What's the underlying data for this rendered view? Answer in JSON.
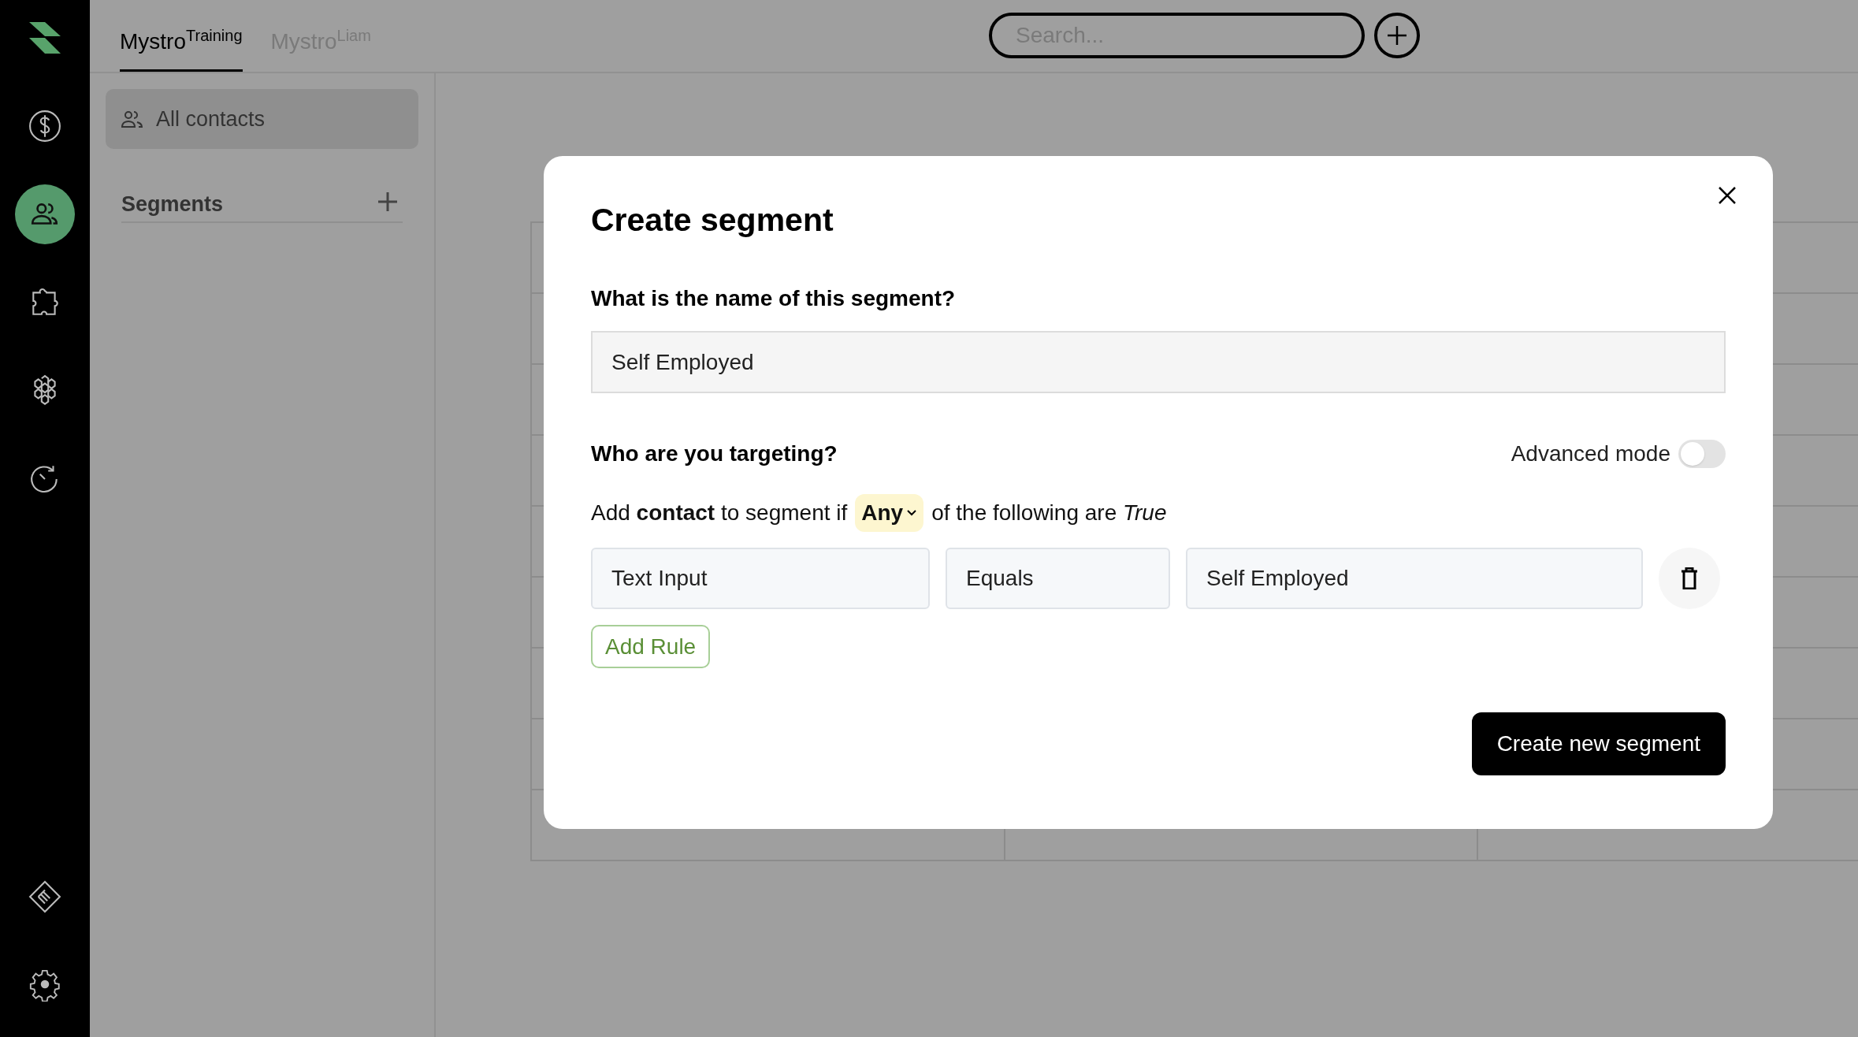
{
  "nav": [
    {
      "selected": false
    },
    {
      "selected": true
    },
    {
      "selected": false
    },
    {
      "selected": false
    },
    {
      "selected": false
    },
    {
      "selected": false
    },
    {
      "selected": false
    }
  ],
  "tabs": [
    {
      "label": "Mystro$^{Training}$",
      "selected": true
    },
    {
      "label": "Mystro$^{Liam}$",
      "selected": false
    }
  ],
  "search": {
    "placeholder": "Search..."
  },
  "contacts_panel": {
    "all_contacts": {
      "label": "All contacts",
      "selected": true
    },
    "segments_heading": "Segments"
  },
  "modal": {
    "title": "Create segment",
    "name_question": "What is the name of this segment?",
    "name_value": "Self Employed",
    "targeting_question": "Who are you targeting?",
    "advanced_mode": {
      "label": "Advanced mode",
      "on": false
    },
    "condition": {
      "prefix": "Add **contact** to segment if",
      "match": "Any",
      "suffix": "of the following are *True*"
    },
    "rules": [
      {
        "field": "Text Input",
        "operator": "Equals",
        "value": "Self Employed"
      }
    ],
    "add_rule": "Add Rule",
    "submit": "Create new segment"
  }
}
